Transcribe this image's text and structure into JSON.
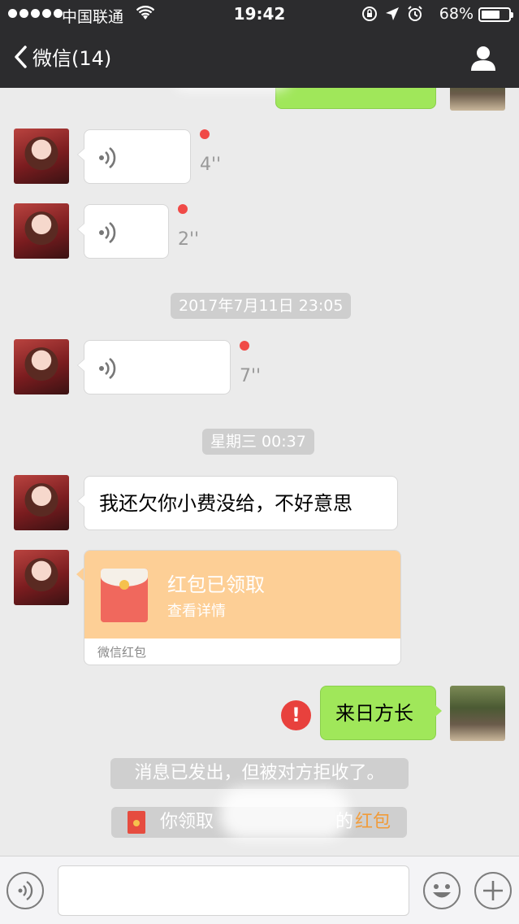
{
  "status_bar": {
    "carrier": "中国联通",
    "time": "19:42",
    "battery_percent": "68%",
    "battery_level": 0.68
  },
  "nav": {
    "back_label": "微信(14)",
    "contact_icon": "person-icon"
  },
  "messages": {
    "voice_1": {
      "duration": "4''",
      "unread": true
    },
    "voice_2": {
      "duration": "2''",
      "unread": true
    },
    "time_1": "2017年7月11日 23:05",
    "voice_3": {
      "duration": "7''",
      "unread": true
    },
    "time_2": "星期三 00:37",
    "text_1": "我还欠你小费没给，不好意思",
    "red_packet": {
      "title": "红包已领取",
      "subtitle": "查看详情",
      "footer": "微信红包"
    },
    "sent_text": "来日方长",
    "error_mark": "!",
    "system_1": "消息已发出，但被对方拒收了。",
    "system_2_prefix": "你领取",
    "system_2_mid": "的",
    "system_2_link": "红包"
  },
  "colors": {
    "nav_bg": "#2c2c2e",
    "chat_bg": "#ebebeb",
    "green_bubble": "#a0e75a",
    "red_packet": "#fdcf96",
    "unread_dot": "#f04a47",
    "error": "#e8413d",
    "link_orange": "#f19b39"
  }
}
